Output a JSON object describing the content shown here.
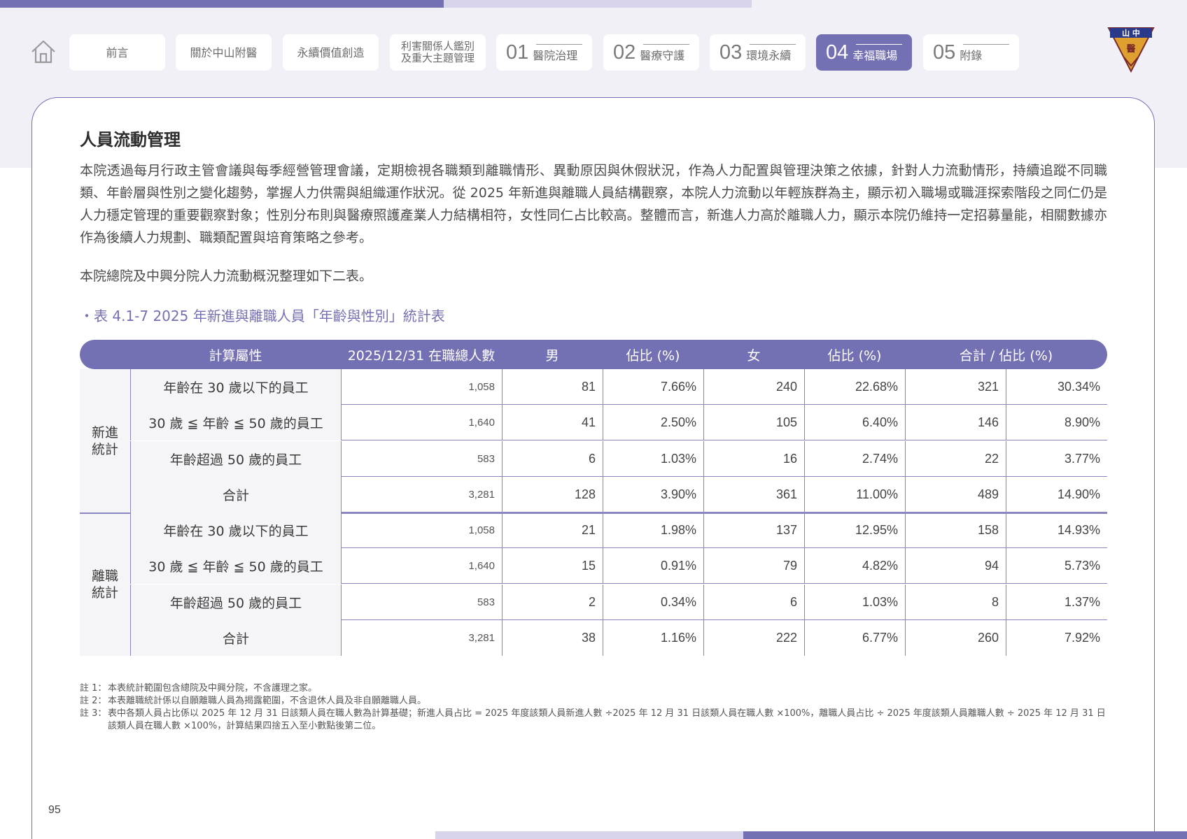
{
  "colors": {
    "accent": "#7470b4",
    "accent_light": "#d6d3ea",
    "header_bg": "#f1f0f7"
  },
  "nav": {
    "home_icon": "home-icon",
    "tabs": [
      {
        "label": "前言"
      },
      {
        "label": "關於中山附醫"
      },
      {
        "label": "永續價值創造"
      },
      {
        "label": "利害關係人鑑別\n及重大主題管理"
      },
      {
        "num": "01",
        "label": "醫院治理"
      },
      {
        "num": "02",
        "label": "醫療守護"
      },
      {
        "num": "03",
        "label": "環境永續"
      },
      {
        "num": "04",
        "label": "幸福職場",
        "active": true
      },
      {
        "num": "05",
        "label": "附錄"
      }
    ],
    "logo_icon": "hospital-emblem-icon",
    "logo_text": "中山醫"
  },
  "section": {
    "title": "人員流動管理",
    "paragraph1": "本院透過每月行政主管會議與每季經營管理會議，定期檢視各職類到離職情形、異動原因與休假狀況，作為人力配置與管理決策之依據，針對人力流動情形，持續追蹤不同職類、年齡層與性別之變化趨勢，掌握人力供需與組織運作狀況。從 2025 年新進與離職人員結構觀察，本院人力流動以年輕族群為主，顯示初入職場或職涯探索階段之同仁仍是人力穩定管理的重要觀察對象；性別分布則與醫療照護產業人力結構相符，女性同仁占比較高。整體而言，新進人力高於離職人力，顯示本院仍維持一定招募量能，相關數據亦作為後續人力規劃、職類配置與培育策略之參考。",
    "paragraph2": "本院總院及中興分院人力流動概況整理如下二表。",
    "table_caption": "・表 4.1-7  2025 年新進與離職人員「年齡與性別」統計表"
  },
  "table": {
    "headers": [
      "計算屬性",
      "2025/12/31 在職總人數",
      "男",
      "佔比 (%)",
      "女",
      "佔比 (%)",
      "合計 / 佔比 (%)"
    ],
    "groups": [
      {
        "name": "新進\n統計",
        "rows": [
          {
            "label": "年齡在 30 歲以下的員工",
            "total": "1,058",
            "male": "81",
            "male_pct": "7.66%",
            "female": "240",
            "female_pct": "22.68%",
            "sum": "321",
            "sum_pct": "30.34%"
          },
          {
            "label": "30 歲 ≦ 年齡 ≦ 50 歲的員工",
            "total": "1,640",
            "male": "41",
            "male_pct": "2.50%",
            "female": "105",
            "female_pct": "6.40%",
            "sum": "146",
            "sum_pct": "8.90%"
          },
          {
            "label": "年齡超過 50 歲的員工",
            "total": "583",
            "male": "6",
            "male_pct": "1.03%",
            "female": "16",
            "female_pct": "2.74%",
            "sum": "22",
            "sum_pct": "3.77%"
          },
          {
            "label": "合計",
            "total": "3,281",
            "male": "128",
            "male_pct": "3.90%",
            "female": "361",
            "female_pct": "11.00%",
            "sum": "489",
            "sum_pct": "14.90%"
          }
        ]
      },
      {
        "name": "離職\n統計",
        "rows": [
          {
            "label": "年齡在 30 歲以下的員工",
            "total": "1,058",
            "male": "21",
            "male_pct": "1.98%",
            "female": "137",
            "female_pct": "12.95%",
            "sum": "158",
            "sum_pct": "14.93%"
          },
          {
            "label": "30 歲 ≦ 年齡 ≦ 50 歲的員工",
            "total": "1,640",
            "male": "15",
            "male_pct": "0.91%",
            "female": "79",
            "female_pct": "4.82%",
            "sum": "94",
            "sum_pct": "5.73%"
          },
          {
            "label": "年齡超過 50 歲的員工",
            "total": "583",
            "male": "2",
            "male_pct": "0.34%",
            "female": "6",
            "female_pct": "1.03%",
            "sum": "8",
            "sum_pct": "1.37%"
          },
          {
            "label": "合計",
            "total": "3,281",
            "male": "38",
            "male_pct": "1.16%",
            "female": "222",
            "female_pct": "6.77%",
            "sum": "260",
            "sum_pct": "7.92%"
          }
        ]
      }
    ]
  },
  "notes": [
    {
      "label": "註 1：",
      "text": "本表統計範圍包含總院及中興分院，不含護理之家。"
    },
    {
      "label": "註 2：",
      "text": "本表離職統計係以自願離職人員為揭露範圍，不含退休人員及非自願離職人員。"
    },
    {
      "label": "註 3：",
      "text": "表中各類人員占比係以 2025 年 12 月 31 日該類人員在職人數為計算基礎；新進人員占比 = 2025 年度該類人員新進人數 ÷2025 年 12 月 31 日該類人員在職人數 ×100%，離職人員占比 ÷ 2025 年度該類人員離職人數 ÷ 2025 年 12 月 31 日該類人員在職人數 ×100%，計算結果四捨五入至小數點後第二位。"
    }
  ],
  "page_number": "95"
}
